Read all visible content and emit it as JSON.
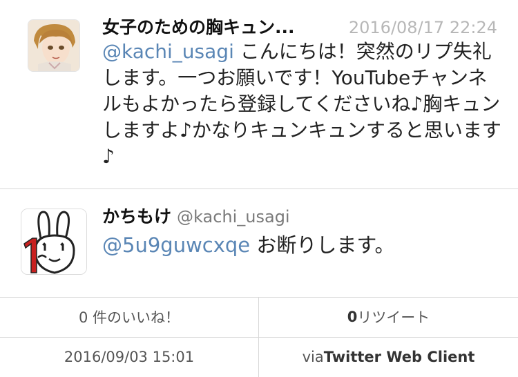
{
  "tweet1": {
    "display_name": "女子のための胸キュン...",
    "timestamp": "2016/08/17 22:24",
    "mention": "@kachi_usagi",
    "text": " こんにちは！突然のリプ失礼します。一つお願いです！YouTubeチャンネルもよかったら登録してくださいね♪胸キュンしますよ♪かなりキュンキュンすると思います♪"
  },
  "tweet2": {
    "display_name": "かちもけ",
    "username": "@kachi_usagi",
    "mention": "@5u9guwcxqe",
    "text": " お断りします。"
  },
  "stats": {
    "likes": "0 件のいいね！",
    "retweet_count": "0",
    "retweet_label": " リツイート",
    "date": "2016/09/03 15:01",
    "via_prefix": "via ",
    "client": "Twitter Web Client"
  },
  "colors": {
    "link": "#5a86b5",
    "divider": "#d7d7d7",
    "timestamp": "#b7b7b7",
    "accent_red": "#c8201f"
  },
  "icons": {
    "avatar1": "anime-boy-avatar",
    "avatar2": "rabbit-avatar"
  }
}
